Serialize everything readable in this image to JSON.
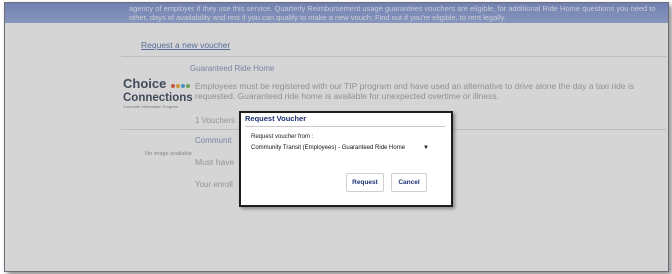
{
  "header": {
    "line1": "agency of employer if they use this service. Quarterly Reimbursement usage guarantees vouchers are eligible, for additional Ride Home questions you need to",
    "line2": "other, days of availability and rest if you can qualify to make a new vouch; Find out if you're eligible, to rent legally."
  },
  "request_link": "Request a new voucher",
  "program": {
    "title": "Guaranteed Ride Home",
    "logo_line1": "Choice",
    "logo_line2": "Connections",
    "logo_tag": "Commute Information Program",
    "logo_dot_colors": [
      "#e0502a",
      "#f0a22a",
      "#3a9ad9",
      "#6ab04c",
      "#9a59b5"
    ],
    "description": "Employees must be registered with our TIP program and have used an alternative to drive alone the day a taxi ride is requested. Guaranteed ride home is available for unexpected overtime or illness.",
    "vouchers_text": "1 Vouchers"
  },
  "community": {
    "title": "Communit",
    "no_image": "No image available",
    "must_have": "Must have",
    "enrollment": "Your enroll"
  },
  "dialog": {
    "title": "Request Voucher",
    "label": "Request voucher from :",
    "selected": "Community Transit (Employees) - Guaranteed Ride Home",
    "request_btn": "Request",
    "cancel_btn": "Cancel"
  }
}
